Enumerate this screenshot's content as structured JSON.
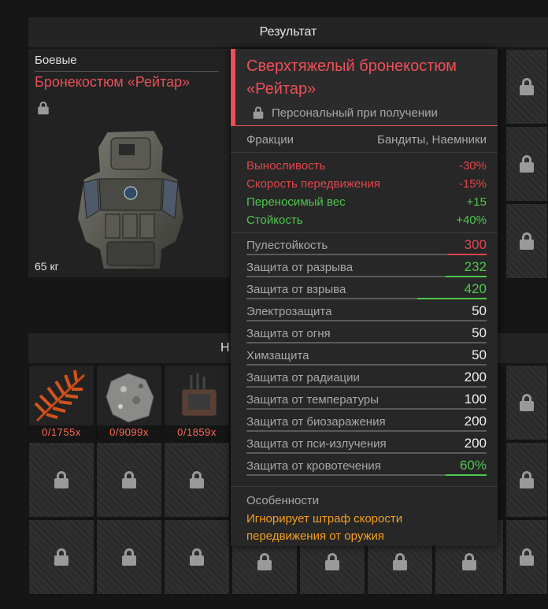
{
  "header": {
    "title": "Результат"
  },
  "section2": {
    "title_visible": "Н"
  },
  "item": {
    "category": "Боевые",
    "name": "Бронекостюм «Рейтар»",
    "weight": "65 кг"
  },
  "materials": [
    {
      "count": "0/1755x",
      "icon": "fern-icon",
      "color": "#d2541e"
    },
    {
      "count": "0/9099x",
      "icon": "rock-icon",
      "color": "#9a9a9a"
    },
    {
      "count": "0/1859x",
      "icon": "device-icon",
      "color": "#6a5040"
    }
  ],
  "tooltip": {
    "title": "Сверхтяжелый бронекостюм «Рейтар»",
    "bound": "Персональный при получении",
    "factions_label": "Фракции",
    "factions_value": "Бандиты, Наемники",
    "modifiers": [
      {
        "label": "Выносливость",
        "value": "-30%",
        "kind": "neg"
      },
      {
        "label": "Скорость передвижения",
        "value": "-15%",
        "kind": "neg"
      },
      {
        "label": "Переносимый вес",
        "value": "+15",
        "kind": "pos"
      },
      {
        "label": "Стойкость",
        "value": "+40%",
        "kind": "pos"
      }
    ],
    "protections": [
      {
        "label": "Пулестойкость",
        "value": "300",
        "kind": "neg",
        "bar": 0.16
      },
      {
        "label": "Защита от разрыва",
        "value": "232",
        "kind": "pos",
        "bar": 0.17
      },
      {
        "label": "Защита от взрыва",
        "value": "420",
        "kind": "pos",
        "bar": 0.29
      },
      {
        "label": "Электрозащита",
        "value": "50",
        "kind": "white",
        "bar": 0
      },
      {
        "label": "Защита от огня",
        "value": "50",
        "kind": "white",
        "bar": 0
      },
      {
        "label": "Химзащита",
        "value": "50",
        "kind": "white",
        "bar": 0
      },
      {
        "label": "Защита от радиации",
        "value": "200",
        "kind": "white",
        "bar": 0
      },
      {
        "label": "Защита от температуры",
        "value": "100",
        "kind": "white",
        "bar": 0
      },
      {
        "label": "Защита от биозаражения",
        "value": "200",
        "kind": "white",
        "bar": 0
      },
      {
        "label": "Защита от пси-излучения",
        "value": "200",
        "kind": "white",
        "bar": 0
      },
      {
        "label": "Защита от кровотечения",
        "value": "60%",
        "kind": "pos",
        "bar": 0.17
      }
    ],
    "features_label": "Особенности",
    "features_text": "Игнорирует штраф скорости передвижения от оружия"
  },
  "colors": {
    "negative": "#e0464e",
    "positive": "#4dc84d",
    "accent": "#e8505a",
    "feature": "#f5a020"
  }
}
